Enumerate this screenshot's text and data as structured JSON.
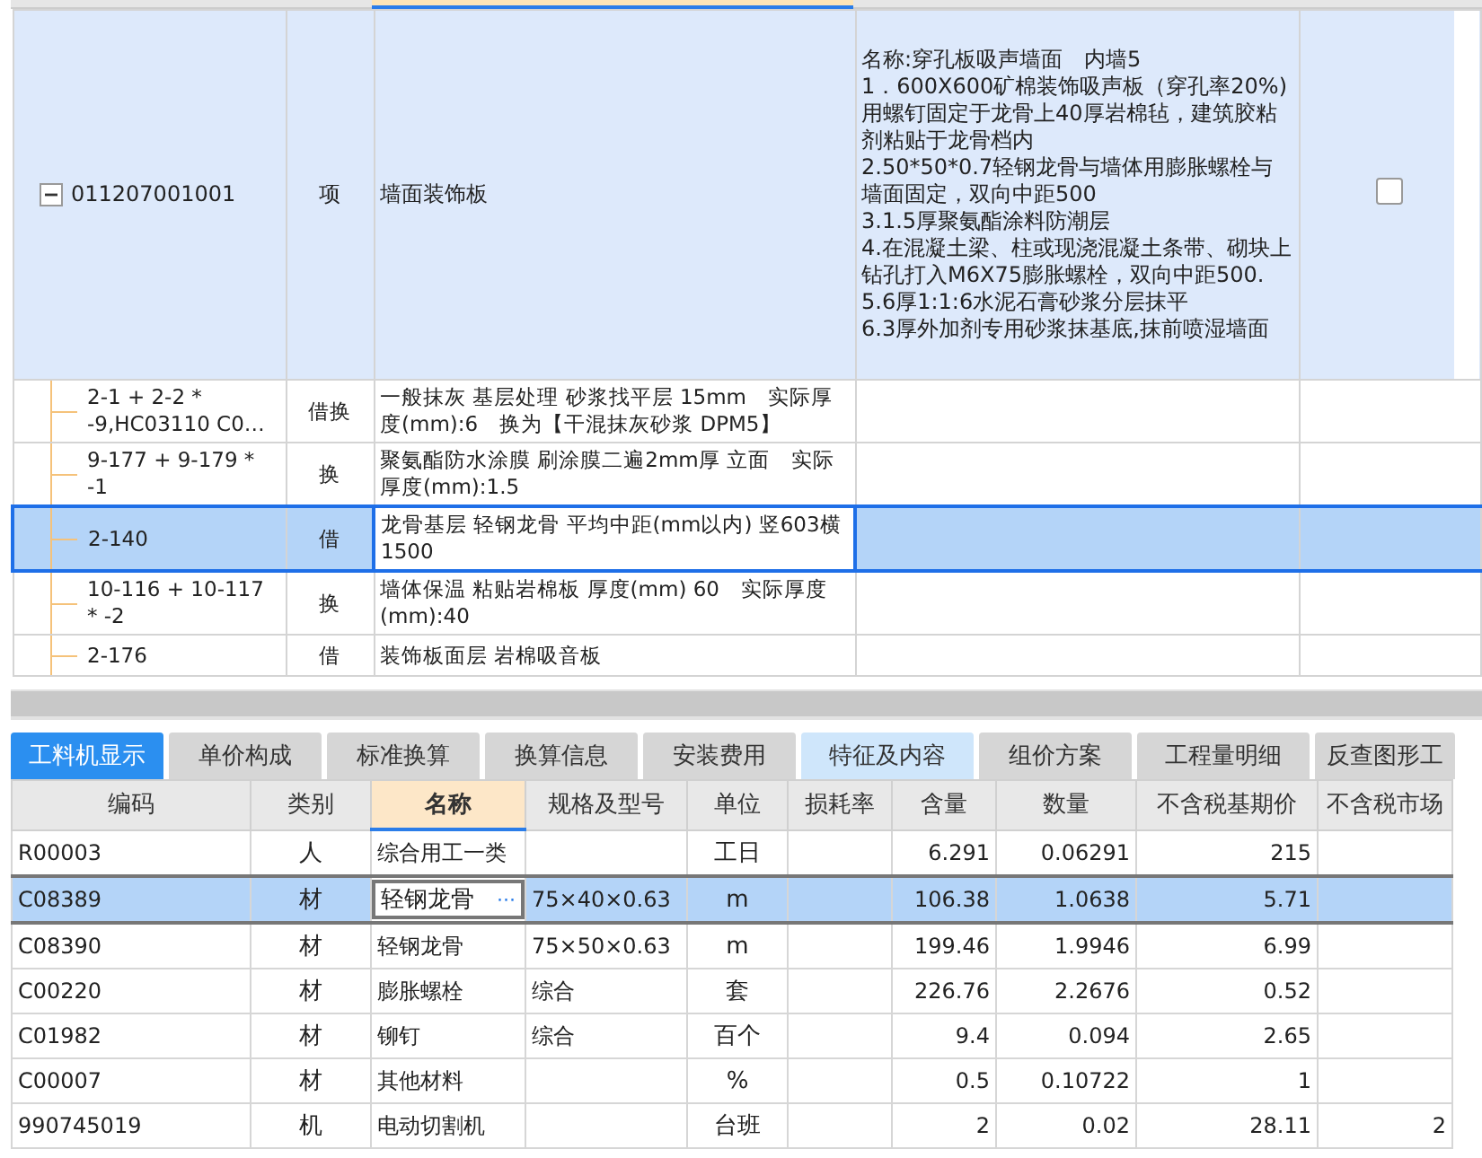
{
  "items": [
    {
      "code": "011207001001",
      "type": "项",
      "name": "墙面装饰板",
      "features": "名称:穿孔板吸声墙面　内墙5\n1．600X600矿棉装饰吸声板（穿孔率20%)用螺钉固定于龙骨上40厚岩棉毡，建筑胶粘剂粘贴于龙骨档内\n2.50*50*0.7轻钢龙骨与墙体用膨胀螺栓与墙面固定，双向中距500\n3.1.5厚聚氨酯涂料防潮层\n4.在混凝土梁、柱或现浇混凝土条带、砌块上钻孔打入M6X75膨胀螺栓，双向中距500.\n5.6厚1:1:6水泥石膏砂浆分层抹平\n6.3厚外加剂专用砂浆抹基底,抹前喷湿墙面",
      "checked": false,
      "expanded": true,
      "selected": false,
      "children": [
        {
          "code": "2-1 + 2-2 * -9,HC03110 C0…",
          "type": "借换",
          "name": "一般抹灰 基层处理 砂浆找平层 15mm　实际厚度(mm):6　换为【干混抹灰砂浆 DPM5】",
          "selected": false
        },
        {
          "code": "9-177 + 9-179 * -1",
          "type": "换",
          "name": "聚氨酯防水涂膜 刷涂膜二遍2mm厚 立面　实际厚度(mm):1.5",
          "selected": false
        },
        {
          "code": "2-140",
          "type": "借",
          "name": "龙骨基层 轻钢龙骨 平均中距(mm以内) 竖603横1500",
          "selected": true
        },
        {
          "code": "10-116 + 10-117 * -2",
          "type": "换",
          "name": "墙体保温 粘贴岩棉板 厚度(mm) 60　实际厚度(mm):40",
          "selected": false
        },
        {
          "code": "2-176",
          "type": "借",
          "name": "装饰板面层 岩棉吸音板",
          "selected": false
        }
      ]
    }
  ],
  "tabs": [
    {
      "label": "工料机显示",
      "selected": true,
      "hovered": false
    },
    {
      "label": "单价构成",
      "selected": false,
      "hovered": false
    },
    {
      "label": "标准换算",
      "selected": false,
      "hovered": false
    },
    {
      "label": "换算信息",
      "selected": false,
      "hovered": false
    },
    {
      "label": "安装费用",
      "selected": false,
      "hovered": false
    },
    {
      "label": "特征及内容",
      "selected": false,
      "hovered": true
    },
    {
      "label": "组价方案",
      "selected": false,
      "hovered": false
    },
    {
      "label": "工程量明细",
      "selected": false,
      "hovered": false
    },
    {
      "label": "反查图形工",
      "selected": false,
      "hovered": false
    }
  ],
  "resources": {
    "columns": [
      {
        "label": "编码",
        "selected": false
      },
      {
        "label": "类别",
        "selected": false
      },
      {
        "label": "名称",
        "selected": true
      },
      {
        "label": "规格及型号",
        "selected": false
      },
      {
        "label": "单位",
        "selected": false
      },
      {
        "label": "损耗率",
        "selected": false
      },
      {
        "label": "含量",
        "selected": false
      },
      {
        "label": "数量",
        "selected": false
      },
      {
        "label": "不含税基期价",
        "selected": false
      },
      {
        "label": "不含税市场",
        "selected": false
      }
    ],
    "rows": [
      {
        "cells": [
          "R00003",
          "人",
          "综合用工一类",
          "",
          "工日",
          "",
          "6.291",
          "0.06291",
          "215",
          ""
        ],
        "selected": false
      },
      {
        "cells": [
          "C08389",
          "材",
          "轻钢龙骨",
          "75×40×0.63",
          "m",
          "",
          "106.38",
          "1.0638",
          "5.71",
          ""
        ],
        "selected": true,
        "edit_button": "···"
      },
      {
        "cells": [
          "C08390",
          "材",
          "轻钢龙骨",
          "75×50×0.63",
          "m",
          "",
          "199.46",
          "1.9946",
          "6.99",
          ""
        ],
        "selected": false
      },
      {
        "cells": [
          "C00220",
          "材",
          "膨胀螺栓",
          "综合",
          "套",
          "",
          "226.76",
          "2.2676",
          "0.52",
          ""
        ],
        "selected": false
      },
      {
        "cells": [
          "C01982",
          "材",
          "铆钉",
          "综合",
          "百个",
          "",
          "9.4",
          "0.094",
          "2.65",
          ""
        ],
        "selected": false
      },
      {
        "cells": [
          "C00007",
          "材",
          "其他材料",
          "",
          "%",
          "",
          "0.5",
          "0.10722",
          "1",
          ""
        ],
        "selected": false
      },
      {
        "cells": [
          "990745019",
          "机",
          "电动切割机",
          "",
          "台班",
          "",
          "2",
          "0.02",
          "28.11",
          "2"
        ],
        "selected": false
      }
    ]
  }
}
